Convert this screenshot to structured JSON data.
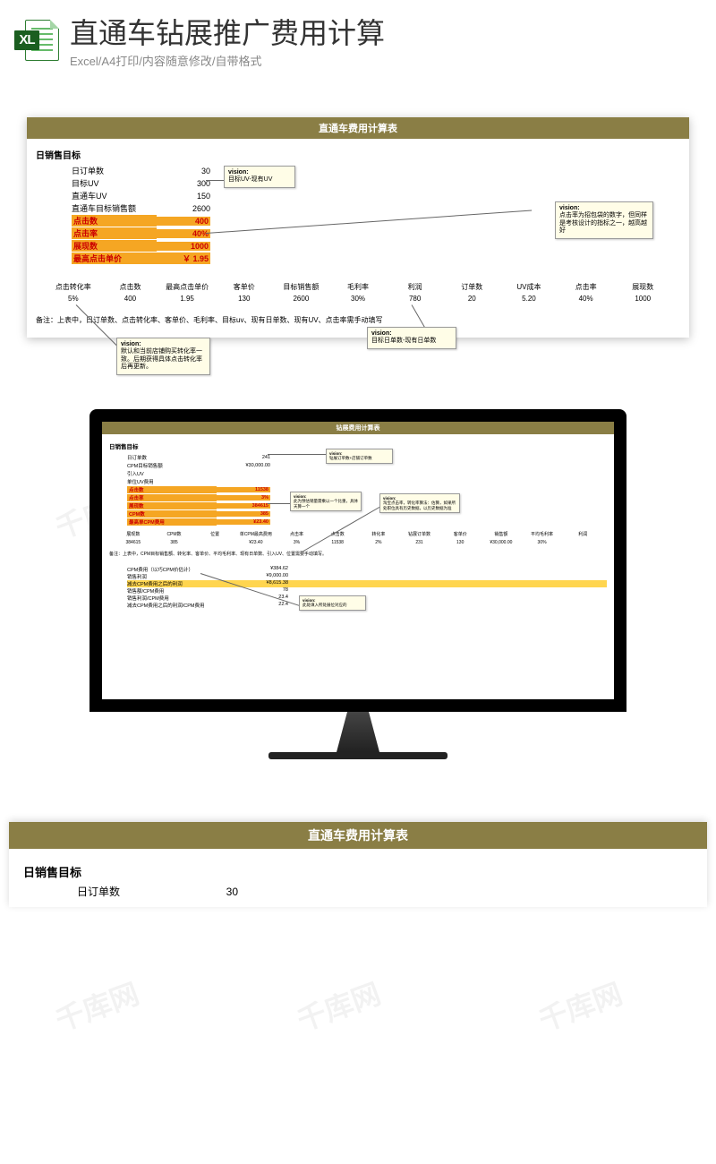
{
  "header": {
    "main_title": "直通车钻展推广费用计算",
    "sub_title": "Excel/A4打印/内容随意修改/自带格式",
    "icon_text": "XL"
  },
  "sheet1": {
    "title": "直通车费用计算表",
    "section": "日销售目标",
    "rows": [
      {
        "k": "日订单数",
        "v": "30"
      },
      {
        "k": "目标UV",
        "v": "300"
      },
      {
        "k": "直通车UV",
        "v": "150"
      },
      {
        "k": "直通车目标销售额",
        "v": "2600"
      }
    ],
    "hlrows": [
      {
        "k": "点击数",
        "v": "400"
      },
      {
        "k": "点击率",
        "v": "40%"
      },
      {
        "k": "展现数",
        "v": "1000"
      },
      {
        "k": "最高点击单价",
        "v": "￥ 1.95"
      }
    ],
    "columns": [
      {
        "h": "点击转化率",
        "v": "5%"
      },
      {
        "h": "点击数",
        "v": "400"
      },
      {
        "h": "最高点击单价",
        "v": "1.95"
      },
      {
        "h": "客单价",
        "v": "130"
      },
      {
        "h": "目标销售额",
        "v": "2600"
      },
      {
        "h": "毛利率",
        "v": "30%"
      },
      {
        "h": "利润",
        "v": "780"
      },
      {
        "h": "订单数",
        "v": "20"
      },
      {
        "h": "UV成本",
        "v": "5.20"
      },
      {
        "h": "点击率",
        "v": "40%"
      },
      {
        "h": "展现数",
        "v": "1000"
      }
    ],
    "note": "备注：上表中，日订单数、点击转化率、客单价、毛利率、目标uv、现有日单数、现有UV、点击率需手动填写",
    "callouts": {
      "c1": {
        "t": "vision:",
        "b": "目标UV-现有UV"
      },
      "c2": {
        "t": "vision:",
        "b": "点击率为招包袋的数字，但同样是考核设计的指标之一，越高越好"
      },
      "c3": {
        "t": "vision:",
        "b": "默认和当前店铺购买转化率一致。后期获得具体点击转化率后再更新。"
      },
      "c4": {
        "t": "vision:",
        "b": "目标日单数-现有日单数"
      }
    }
  },
  "sheet2": {
    "title": "钻展费用计算表",
    "section": "日销售目标",
    "rows": [
      {
        "k": "日订单数",
        "v": "241"
      },
      {
        "k": "CPM目标销售额",
        "v": "¥30,000.00"
      },
      {
        "k": "引入UV",
        "v": ""
      },
      {
        "k": "单位UV费用",
        "v": ""
      }
    ],
    "hlrows": [
      {
        "k": "点击数",
        "v": "11538"
      },
      {
        "k": "点击率",
        "v": "3%"
      },
      {
        "k": "展现数",
        "v": "384615"
      },
      {
        "k": "CPM数",
        "v": "385"
      },
      {
        "k": "最高单CPM费用",
        "v": "¥23.40"
      }
    ],
    "columns": [
      {
        "h": "展现数",
        "v": "384615"
      },
      {
        "h": "CPM数",
        "v": "385"
      },
      {
        "h": "位置",
        "v": ""
      },
      {
        "h": "单CPM最高费用",
        "v": "¥23.40"
      },
      {
        "h": "点击率",
        "v": "3%"
      },
      {
        "h": "点击数",
        "v": "11538"
      },
      {
        "h": "转化率",
        "v": "2%"
      },
      {
        "h": "钻展订单数",
        "v": "231"
      },
      {
        "h": "客单价",
        "v": "130"
      },
      {
        "h": "销售额",
        "v": "¥30,000.00"
      },
      {
        "h": "平均毛利率",
        "v": "30%"
      },
      {
        "h": "利润",
        "v": ""
      }
    ],
    "note": "备注：上表中，CPM目标销售额、转化率、客单价、平均毛利率、现有日单数、引入UV、位置需要手动填写。",
    "summary": [
      {
        "k": "CPM费用（以巧CPM价估计）",
        "v": "¥384.62"
      },
      {
        "k": "销售利润",
        "v": "¥9,000.00"
      },
      {
        "k": "减去CPM费用之后的利润",
        "v": "¥8,615.38",
        "hl": true
      },
      {
        "k": "销售额/CPM费用",
        "v": "78"
      },
      {
        "k": "销售利润/CPM费用",
        "v": "23.4"
      },
      {
        "k": "减去CPM费用之后的利润/CPM费用",
        "v": "22.4"
      }
    ],
    "callouts": {
      "c1": {
        "t": "vision:",
        "b": "钻展订单数+店铺订单数"
      },
      "c2": {
        "t": "vision:",
        "b": "此为预估销量需乘以一个比重，具体天算一个"
      },
      "c3": {
        "t": "vision:",
        "b": "淘宝点击率，转化率算法：估算，如果所处职位具有历史数据，以历史数据为准"
      },
      "c4": {
        "t": "vision:",
        "b": "此处填入所处展位对应的"
      }
    }
  },
  "sheet3": {
    "title": "直通车费用计算表",
    "section": "日销售目标",
    "row1": {
      "k": "日订单数",
      "v": "30"
    }
  },
  "watermark": "千库网"
}
